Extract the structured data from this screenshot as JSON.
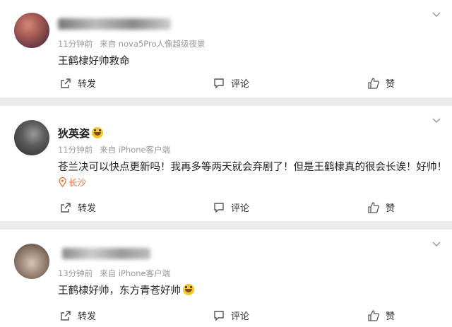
{
  "posts": [
    {
      "username": "",
      "time": "11分钟前",
      "source": "来自 nova5Pro人像超级夜景",
      "text": "王鹤棣好帅救命",
      "location": "",
      "actions": {
        "repost": "转发",
        "comment": "评论",
        "like": "赞"
      }
    },
    {
      "username": "狄英姿",
      "time": "11分钟前",
      "source": "来自 iPhone客户端",
      "text": "苍兰决可以快点更新吗！我再多等两天就会弃剧了！但是王鹤棣真的很会长诶！好帅！",
      "location": "长沙",
      "actions": {
        "repost": "转发",
        "comment": "评论",
        "like": "赞"
      }
    },
    {
      "username": "",
      "time": "13分钟前",
      "source": "来自 iPhone客户端",
      "text": "王鹤棣好帅，东方青苍好帅",
      "location": "",
      "actions": {
        "repost": "转发",
        "comment": "评论",
        "like": "赞"
      }
    }
  ],
  "icons": {
    "more": "chevron-down-icon",
    "repost": "share-icon",
    "comment": "comment-icon",
    "like": "thumbs-up-icon",
    "location": "location-pin-icon"
  },
  "colors": {
    "background": "#ebebeb",
    "card": "#ffffff",
    "location": "#e86e33",
    "meta": "#999999"
  }
}
